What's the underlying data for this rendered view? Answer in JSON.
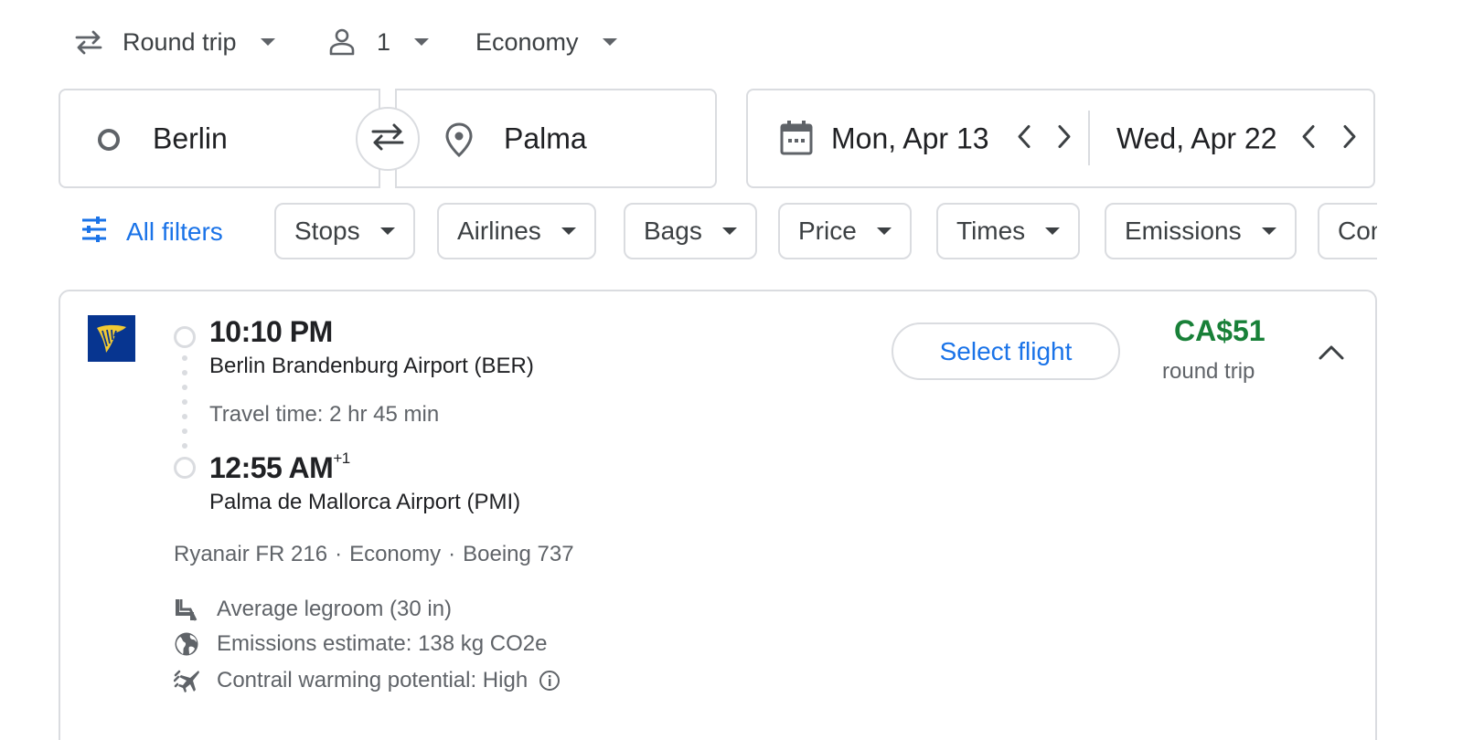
{
  "trip_options": {
    "trip_type": "Round trip",
    "passengers": "1",
    "cabin_class": "Economy"
  },
  "search": {
    "origin": "Berlin",
    "destination": "Palma",
    "depart_date": "Mon, Apr 13",
    "return_date": "Wed, Apr 22"
  },
  "filters": {
    "all_filters_label": "All filters",
    "chips": [
      "Stops",
      "Airlines",
      "Bags",
      "Price",
      "Times",
      "Emissions",
      "Connecting airports"
    ]
  },
  "flight": {
    "airline_logo": "ryanair-harp-logo",
    "depart_time": "10:10 PM",
    "depart_airport": "Berlin Brandenburg Airport (BER)",
    "travel_time": "Travel time: 2 hr 45 min",
    "arrive_time": "12:55 AM",
    "arrive_day_offset": "+1",
    "arrive_airport": "Palma de Mallorca Airport (PMI)",
    "airline_flight": "Ryanair FR 216",
    "cabin": "Economy",
    "aircraft": "Boeing 737",
    "separator": "·",
    "legroom": "Average legroom (30 in)",
    "emissions": "Emissions estimate: 138 kg CO2e",
    "contrail": "Contrail warming potential: High",
    "select_label": "Select flight",
    "price": "CA$51",
    "price_note": "round trip"
  },
  "colors": {
    "accent_blue": "#1a73e8",
    "price_green": "#188038",
    "border": "#dadce0",
    "ryanair_blue": "#073590",
    "ryanair_yellow": "#f1c933"
  }
}
